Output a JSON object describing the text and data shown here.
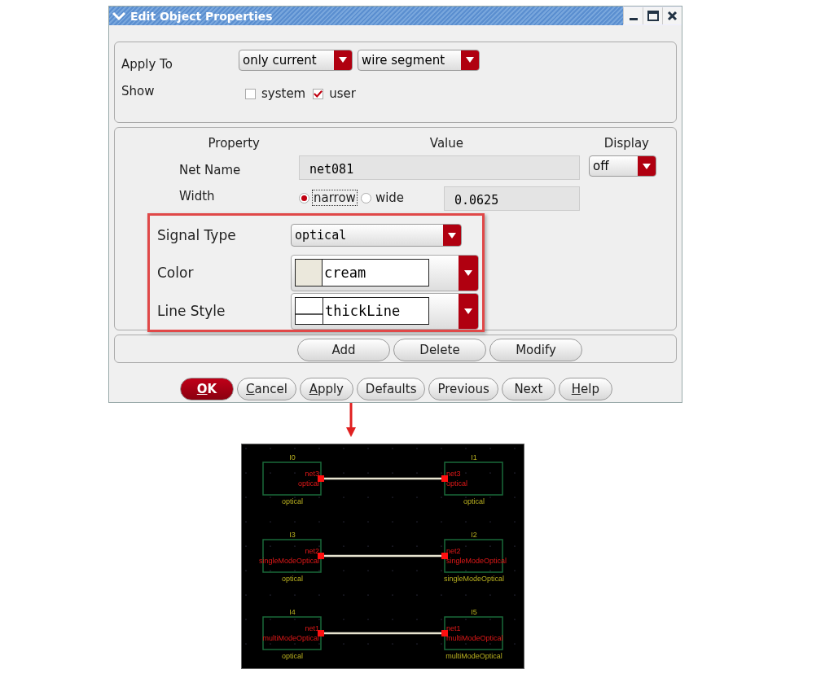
{
  "window": {
    "title": "Edit Object Properties"
  },
  "apply_to": {
    "label": "Apply To",
    "dropdowns": [
      {
        "value": "only current"
      },
      {
        "value": "wire segment"
      }
    ]
  },
  "show": {
    "label": "Show",
    "options": [
      {
        "label": "system",
        "checked": false
      },
      {
        "label": "user",
        "checked": true
      }
    ]
  },
  "properties": {
    "columns": [
      "Property",
      "Value",
      "Display"
    ],
    "net_name": {
      "label": "Net Name",
      "value": "net081",
      "display": "off"
    },
    "width": {
      "label": "Width",
      "options": [
        {
          "label": "narrow",
          "selected": true
        },
        {
          "label": "wide",
          "selected": false
        }
      ],
      "value": "0.0625"
    }
  },
  "overlay": {
    "rows": [
      {
        "kind": "dropdown",
        "label": "Signal Type",
        "value": "optical"
      },
      {
        "kind": "color",
        "label": "Color",
        "value": "cream",
        "color": "#ebe8dc"
      },
      {
        "kind": "line",
        "label": "Line Style",
        "value": "thickLine"
      }
    ]
  },
  "edit_buttons": [
    "Add",
    "Delete",
    "Modify"
  ],
  "buttons": [
    {
      "label": "OK",
      "primary": true,
      "mnemonic": true
    },
    {
      "label": "Cancel",
      "primary": false,
      "mnemonic": true
    },
    {
      "label": "Apply",
      "primary": false,
      "mnemonic": true
    },
    {
      "label": "Defaults",
      "primary": false,
      "mnemonic": false
    },
    {
      "label": "Previous",
      "primary": false,
      "mnemonic": false
    },
    {
      "label": "Next",
      "primary": false,
      "mnemonic": false
    },
    {
      "label": "Help",
      "primary": false,
      "mnemonic": true
    }
  ],
  "schematic": {
    "rows": [
      {
        "left": {
          "name": "I0",
          "net": "net3",
          "type": "optical",
          "label": "optical"
        },
        "right": {
          "name": "I1",
          "net": "net3",
          "type": "optical",
          "label": "optical"
        }
      },
      {
        "left": {
          "name": "I3",
          "net": "net2",
          "type": "singleModeOptical",
          "label": "optical"
        },
        "right": {
          "name": "I2",
          "net": "net2",
          "type": "singleModeOptical",
          "label": "singleModeOptical"
        }
      },
      {
        "left": {
          "name": "I4",
          "net": "net1",
          "type": "multiModeOptical",
          "label": "optical"
        },
        "right": {
          "name": "I5",
          "net": "net1",
          "type": "multiModeOptical",
          "label": "multiModeOptical"
        }
      }
    ]
  }
}
